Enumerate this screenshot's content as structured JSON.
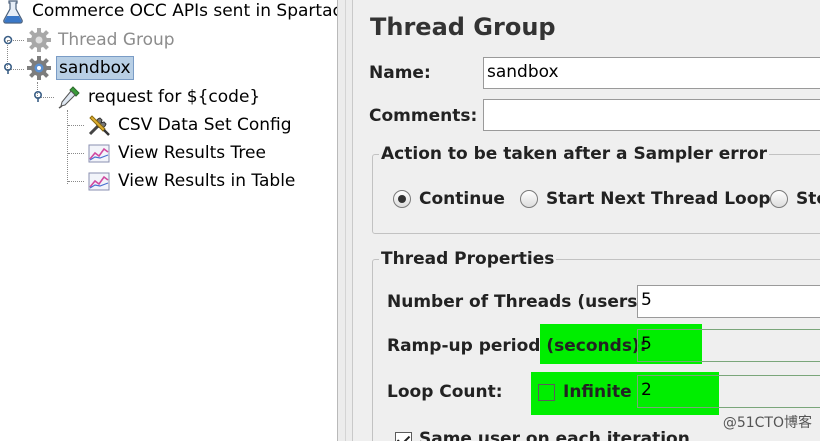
{
  "tree": {
    "items": [
      {
        "label": "Commerce OCC APIs sent in Spartacu",
        "icon": "flask-icon"
      },
      {
        "label": "Thread Group",
        "icon": "gear-icon",
        "disabled": true
      },
      {
        "label": "sandbox",
        "icon": "gear-icon",
        "selected": true
      },
      {
        "label": "request for ${code}",
        "icon": "pipette-icon"
      },
      {
        "label": "CSV Data Set Config",
        "icon": "wrench-screwdriver-icon"
      },
      {
        "label": "View Results Tree",
        "icon": "graph-icon"
      },
      {
        "label": "View Results in Table",
        "icon": "graph-icon"
      }
    ]
  },
  "panel": {
    "title": "Thread Group",
    "name_label": "Name:",
    "name_value": "sandbox",
    "comments_label": "Comments:",
    "comments_value": "",
    "sampler_error": {
      "title": "Action to be taken after a Sampler error",
      "options": [
        {
          "label": "Continue",
          "checked": true
        },
        {
          "label": "Start Next Thread Loop",
          "checked": false
        },
        {
          "label": "Sto",
          "checked": false
        }
      ]
    },
    "thread_props": {
      "title": "Thread Properties",
      "threads_label": "Number of Threads (users):",
      "threads_value": "5",
      "rampup_label": "Ramp-up period (seconds):",
      "rampup_value": "5",
      "loop_label": "Loop Count:",
      "infinite_label": "Infinite",
      "infinite_checked": false,
      "loop_value": "2",
      "same_user_label": "Same user on each iteration",
      "same_user_checked": true
    }
  },
  "watermark": "@51CTO博客",
  "colors": {
    "highlight": "#00ee00",
    "selection": "#b8cfe5"
  }
}
